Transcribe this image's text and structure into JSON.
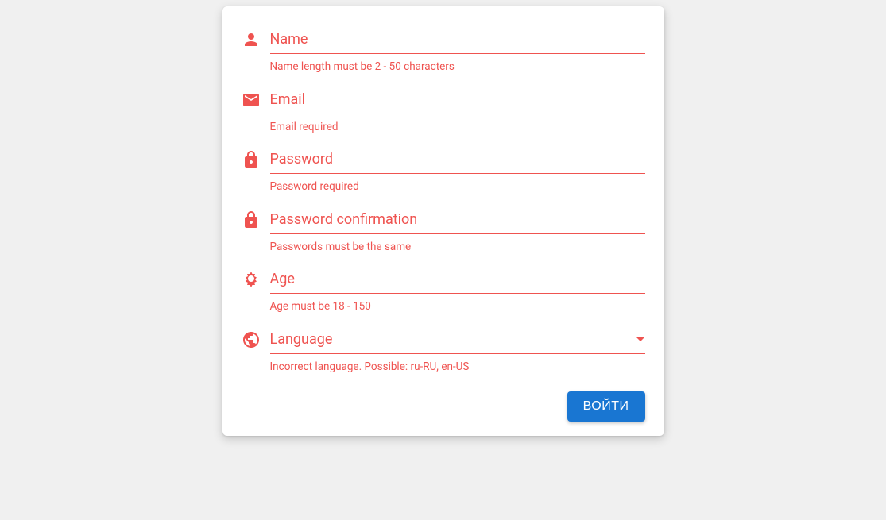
{
  "colors": {
    "error": "#ef5350",
    "primary": "#1976d2"
  },
  "fields": {
    "name": {
      "label": "Name",
      "hint": "Name length must be 2 - 50 characters",
      "value": ""
    },
    "email": {
      "label": "Email",
      "hint": "Email required",
      "value": ""
    },
    "password": {
      "label": "Password",
      "hint": "Password required",
      "value": ""
    },
    "password_confirmation": {
      "label": "Password confirmation",
      "hint": "Passwords must be the same",
      "value": ""
    },
    "age": {
      "label": "Age",
      "hint": "Age must be 18 - 150",
      "value": ""
    },
    "language": {
      "label": "Language",
      "hint": "Incorrect language. Possible: ru-RU, en-US",
      "selected": ""
    }
  },
  "submit_label": "ВОЙТИ"
}
